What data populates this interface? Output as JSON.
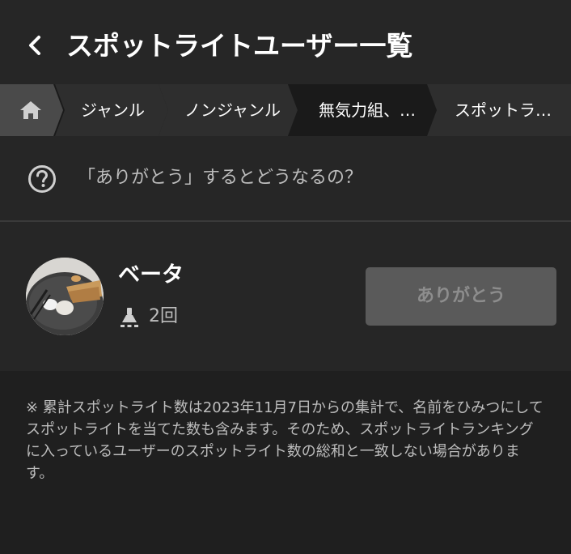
{
  "header": {
    "title": "スポットライトユーザー一覧",
    "back_icon": "chevron-left-icon"
  },
  "breadcrumb": {
    "home_icon": "home-icon",
    "items": [
      {
        "label": "ジャンル"
      },
      {
        "label": "ノンジャンル"
      },
      {
        "label": "無気力組、…"
      },
      {
        "label": "スポットラ…"
      }
    ]
  },
  "help": {
    "icon": "question-circle-icon",
    "text": "「ありがとう」するとどうなるの？"
  },
  "user": {
    "name": "ベータ",
    "spotlight_icon": "spotlight-icon",
    "spotlight_count": "2回",
    "thanks_label": "ありがとう"
  },
  "footnote": "※ 累計スポットライト数は2023年11月7日からの集計で、名前をひみつにしてスポットライトを当てた数も含みます。そのため、スポットライトランキングに入っているユーザーのスポットライト数の総和と一致しない場合があります。",
  "colors": {
    "background": "#1f1f1f",
    "panel": "#262626",
    "crumb_home": "#4a4a4a",
    "crumb": "#2e2e2e",
    "button_disabled": "#5a5a5a"
  }
}
